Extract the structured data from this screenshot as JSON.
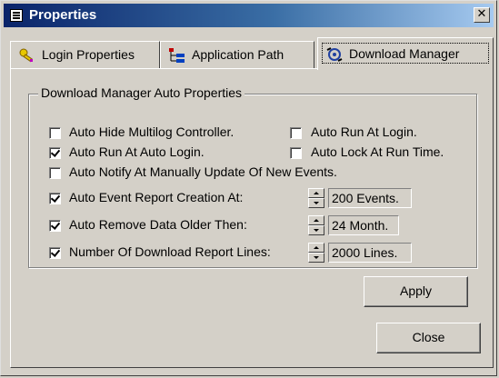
{
  "window": {
    "title": "Properties",
    "close_glyph": "✕"
  },
  "tabs": [
    {
      "label": "Login Properties",
      "icon": "key-icon"
    },
    {
      "label": "Application Path",
      "icon": "tree-icon"
    },
    {
      "label": "Download Manager",
      "icon": "gear-icon",
      "active": true
    }
  ],
  "group": {
    "title": "Download Manager Auto Properties"
  },
  "options": {
    "auto_hide": {
      "label": "Auto Hide Multilog Controller.",
      "checked": false
    },
    "auto_run_login": {
      "label": "Auto Run At Login.",
      "checked": false
    },
    "auto_run_auto_login": {
      "label": "Auto Run At Auto Login.",
      "checked": true
    },
    "auto_lock": {
      "label": "Auto Lock At Run Time.",
      "checked": false
    },
    "auto_notify": {
      "label": "Auto Notify At Manually Update Of New Events.",
      "checked": false
    },
    "event_report": {
      "label": "Auto Event Report Creation At:",
      "checked": true,
      "value": "200 Events."
    },
    "remove_data": {
      "label": "Auto Remove Data Older Then:",
      "checked": true,
      "value": "24 Month."
    },
    "report_lines": {
      "label": "Number Of Download Report Lines:",
      "checked": true,
      "value": "2000 Lines."
    }
  },
  "buttons": {
    "apply": "Apply",
    "close": "Close"
  },
  "colors": {
    "face": "#d4d0c8",
    "title_start": "#0a246a",
    "title_end": "#a6caf0"
  }
}
